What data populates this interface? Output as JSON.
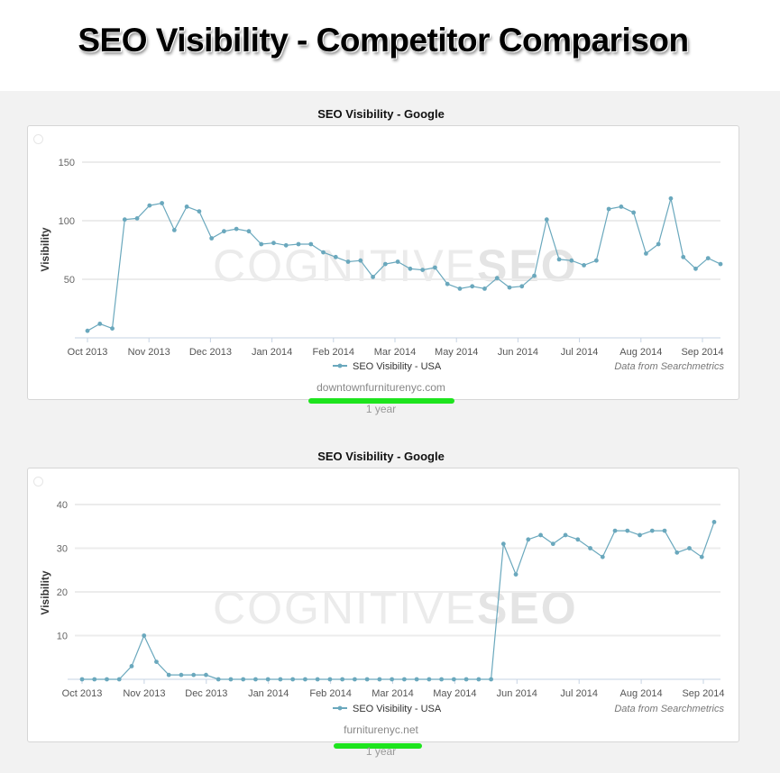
{
  "page": {
    "title": "SEO Visibility - Competitor Comparison"
  },
  "charts_meta": [
    {
      "domain_label": "downtownfurniturenyc.com",
      "period_label": "1 year",
      "credit": "Data from Searchmetrics",
      "watermark_light": "COGNITIVE",
      "watermark_bold": "SEO"
    },
    {
      "domain_label": "furniturenyc.net",
      "period_label": "1 year",
      "credit": "Data from Searchmetrics",
      "watermark_light": "COGNITIVE",
      "watermark_bold": "SEO"
    }
  ],
  "colors": {
    "series": "#6aa8bd",
    "highlight": "#1ee41e",
    "grid": "#ececec",
    "axis": "#c6d3e3"
  },
  "chart_data": [
    {
      "type": "line",
      "title": "SEO Visibility - Google",
      "xlabel": "",
      "ylabel": "Visibility",
      "ylim": [
        0,
        150
      ],
      "yticks": [
        50,
        100,
        150
      ],
      "xtick_labels": [
        "Oct 2013",
        "Nov 2013",
        "Dec 2013",
        "Jan 2014",
        "Feb 2014",
        "Mar 2014",
        "May 2014",
        "Jun 2014",
        "Jul 2014",
        "Aug 2014",
        "Sep 2014"
      ],
      "grid": true,
      "legend": "bottom-center",
      "series": [
        {
          "name": "SEO Visibility - USA",
          "values": [
            6,
            12,
            8,
            101,
            102,
            113,
            115,
            92,
            112,
            108,
            85,
            91,
            93,
            91,
            80,
            81,
            79,
            80,
            80,
            73,
            69,
            65,
            66,
            52,
            63,
            65,
            59,
            58,
            60,
            46,
            42,
            44,
            42,
            51,
            43,
            44,
            53,
            101,
            67,
            66,
            62,
            66,
            110,
            112,
            107,
            72,
            80,
            119,
            69,
            59,
            68,
            63
          ]
        }
      ]
    },
    {
      "type": "line",
      "title": "SEO Visibility - Google",
      "xlabel": "",
      "ylabel": "Visibility",
      "ylim": [
        0,
        40
      ],
      "yticks": [
        10,
        20,
        30,
        40
      ],
      "xtick_labels": [
        "Oct 2013",
        "Nov 2013",
        "Dec 2013",
        "Jan 2014",
        "Feb 2014",
        "Mar 2014",
        "May 2014",
        "Jun 2014",
        "Jul 2014",
        "Aug 2014",
        "Sep 2014"
      ],
      "grid": true,
      "legend": "bottom-center",
      "series": [
        {
          "name": "SEO Visibility - USA",
          "values": [
            0,
            0,
            0,
            0,
            3,
            10,
            4,
            1,
            1,
            1,
            1,
            0,
            0,
            0,
            0,
            0,
            0,
            0,
            0,
            0,
            0,
            0,
            0,
            0,
            0,
            0,
            0,
            0,
            0,
            0,
            0,
            0,
            0,
            0,
            31,
            24,
            32,
            33,
            31,
            33,
            32,
            30,
            28,
            34,
            34,
            33,
            34,
            34,
            29,
            30,
            28,
            36
          ]
        }
      ]
    }
  ]
}
